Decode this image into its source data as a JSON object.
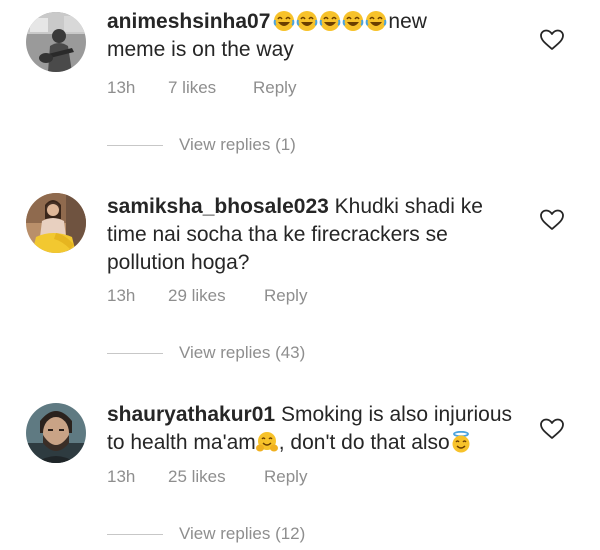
{
  "comments": [
    {
      "username": "animeshsinha07",
      "text_before": "",
      "emojis_inline": 5,
      "text_after_emojis": "new",
      "line2": "meme is on the way",
      "time": "13h",
      "likes": "7 likes",
      "reply": "Reply",
      "view_replies": "View replies (1)",
      "avatar_icon": "avatar-guitar-photo"
    },
    {
      "username": "samiksha_bhosale023",
      "line1_rest": "Khudki shadi ke",
      "line2": "time nai socha tha ke firecrackers se",
      "line3": "pollution hoga?",
      "time": "13h",
      "likes": "29 likes",
      "reply": "Reply",
      "view_replies": "View replies (43)",
      "avatar_icon": "avatar-woman-photo"
    },
    {
      "username": "shauryathakur01",
      "line1_rest": "Smoking is also injurious",
      "line2_a": "to health ma'am",
      "line2_b": ", don't do that also",
      "time": "13h",
      "likes": "25 likes",
      "reply": "Reply",
      "view_replies": "View replies (12)",
      "avatar_icon": "avatar-man-photo"
    }
  ],
  "colors": {
    "text": "#262626",
    "meta": "#8e8e8e",
    "divider": "#c7c7c7",
    "emoji_yellow": "#f7c22a"
  }
}
